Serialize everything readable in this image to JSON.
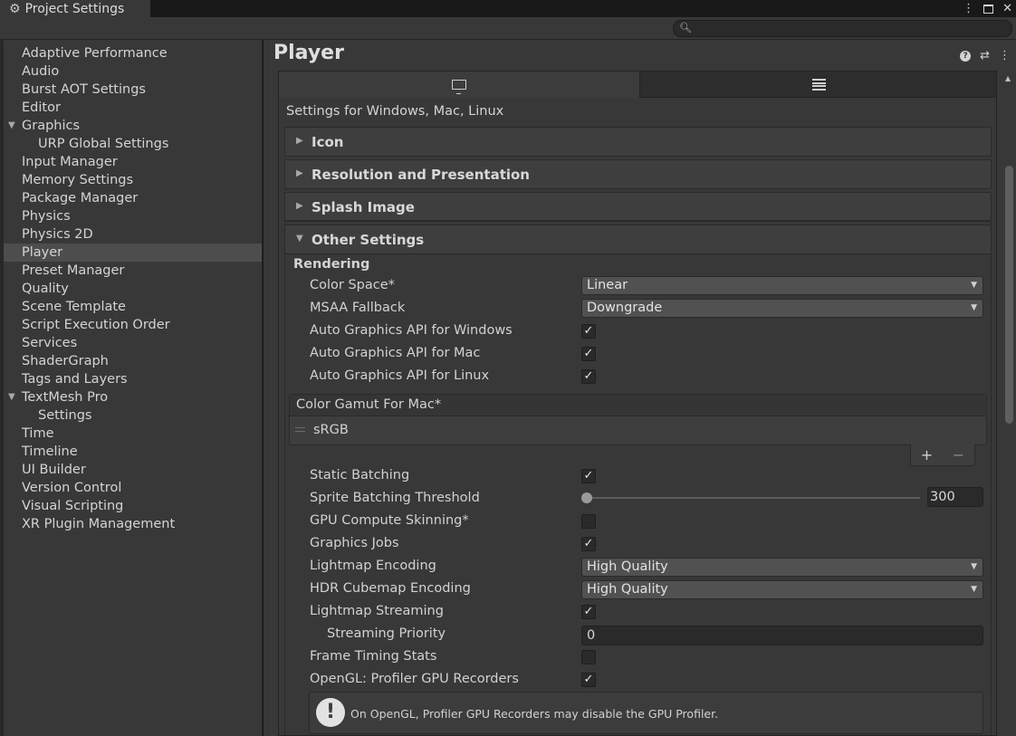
{
  "window": {
    "title": "Project Settings",
    "icons": [
      "gear-icon",
      "more-icon",
      "maximize-icon",
      "close-icon"
    ]
  },
  "search": {
    "placeholder": ""
  },
  "sidebar": {
    "items": [
      {
        "label": "Adaptive Performance",
        "level": 0
      },
      {
        "label": "Audio",
        "level": 0
      },
      {
        "label": "Burst AOT Settings",
        "level": 0
      },
      {
        "label": "Editor",
        "level": 0
      },
      {
        "label": "Graphics",
        "level": 0,
        "expanded": true
      },
      {
        "label": "URP Global Settings",
        "level": 1
      },
      {
        "label": "Input Manager",
        "level": 0
      },
      {
        "label": "Memory Settings",
        "level": 0
      },
      {
        "label": "Package Manager",
        "level": 0
      },
      {
        "label": "Physics",
        "level": 0
      },
      {
        "label": "Physics 2D",
        "level": 0
      },
      {
        "label": "Player",
        "level": 0,
        "selected": true
      },
      {
        "label": "Preset Manager",
        "level": 0
      },
      {
        "label": "Quality",
        "level": 0
      },
      {
        "label": "Scene Template",
        "level": 0
      },
      {
        "label": "Script Execution Order",
        "level": 0
      },
      {
        "label": "Services",
        "level": 0
      },
      {
        "label": "ShaderGraph",
        "level": 0
      },
      {
        "label": "Tags and Layers",
        "level": 0
      },
      {
        "label": "TextMesh Pro",
        "level": 0,
        "expanded": true
      },
      {
        "label": "Settings",
        "level": 1
      },
      {
        "label": "Time",
        "level": 0
      },
      {
        "label": "Timeline",
        "level": 0
      },
      {
        "label": "UI Builder",
        "level": 0
      },
      {
        "label": "Version Control",
        "level": 0
      },
      {
        "label": "Visual Scripting",
        "level": 0
      },
      {
        "label": "XR Plugin Management",
        "level": 0
      }
    ]
  },
  "main": {
    "title": "Player",
    "platform_label": "Settings for Windows, Mac, Linux",
    "sections": {
      "icon": "Icon",
      "resolution": "Resolution and Presentation",
      "splash": "Splash Image",
      "other": "Other Settings"
    },
    "rendering": {
      "title": "Rendering",
      "color_space": {
        "label": "Color Space*",
        "value": "Linear"
      },
      "msaa_fallback": {
        "label": "MSAA Fallback",
        "value": "Downgrade"
      },
      "auto_api_windows": {
        "label": "Auto Graphics API  for Windows",
        "checked": true
      },
      "auto_api_mac": {
        "label": "Auto Graphics API  for Mac",
        "checked": true
      },
      "auto_api_linux": {
        "label": "Auto Graphics API  for Linux",
        "checked": true
      },
      "color_gamut": {
        "label": "Color Gamut For Mac*",
        "items": [
          "sRGB"
        ]
      },
      "static_batching": {
        "label": "Static Batching",
        "checked": true
      },
      "sprite_batching": {
        "label": "Sprite Batching Threshold",
        "value": "300",
        "slider_fraction": 0.0
      },
      "gpu_skinning": {
        "label": "GPU Compute Skinning*",
        "checked": false
      },
      "graphics_jobs": {
        "label": "Graphics Jobs",
        "checked": true
      },
      "lightmap_encoding": {
        "label": "Lightmap Encoding",
        "value": "High Quality"
      },
      "hdr_cubemap": {
        "label": "HDR Cubemap Encoding",
        "value": "High Quality"
      },
      "lightmap_streaming": {
        "label": "Lightmap Streaming",
        "checked": true
      },
      "streaming_priority": {
        "label": "Streaming Priority",
        "value": "0"
      },
      "frame_timing": {
        "label": "Frame Timing Stats",
        "checked": false
      },
      "gl_profiler": {
        "label": "OpenGL: Profiler GPU Recorders",
        "checked": true
      },
      "warning": "On OpenGL, Profiler GPU Recorders may disable the GPU Profiler."
    }
  },
  "colors": {
    "background": "#383838",
    "selected": "#4d4d4d",
    "field": "#2a2a2a",
    "dropdown": "#515151"
  }
}
